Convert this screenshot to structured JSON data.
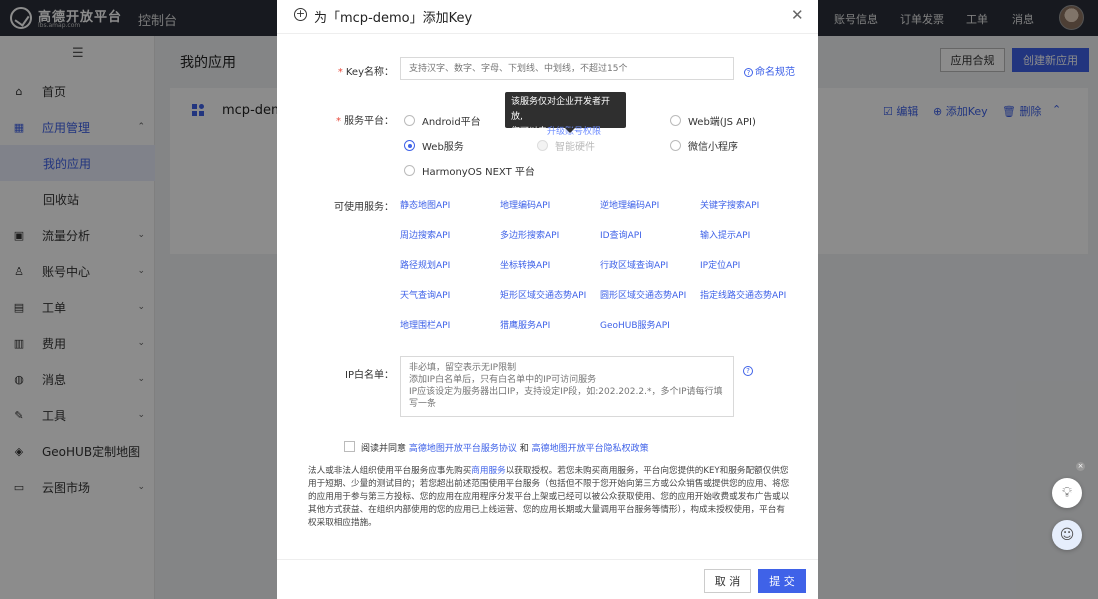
{
  "topbar": {
    "logo_title": "高德开放平台",
    "logo_subtitle": "lbs.amap.com",
    "console": "控制台",
    "nav": [
      "账号信息",
      "订单发票",
      "工单",
      "消息"
    ]
  },
  "sidebar": {
    "items": [
      {
        "label": "首页",
        "icon": "home-icon"
      },
      {
        "label": "应用管理",
        "icon": "grid-icon"
      },
      {
        "label": "我的应用"
      },
      {
        "label": "回收站"
      },
      {
        "label": "流量分析",
        "icon": "chart-icon"
      },
      {
        "label": "账号中心",
        "icon": "user-icon"
      },
      {
        "label": "工单",
        "icon": "ticket-icon"
      },
      {
        "label": "费用",
        "icon": "money-icon"
      },
      {
        "label": "消息",
        "icon": "message-icon"
      },
      {
        "label": "工具",
        "icon": "wrench-icon"
      },
      {
        "label": "GeoHUB定制地图",
        "icon": "layers-icon"
      },
      {
        "label": "云图市场",
        "icon": "cloud-icon"
      }
    ]
  },
  "main": {
    "title": "我的应用",
    "compliance_button": "应用合规",
    "create_button": "创建新应用",
    "app_name": "mcp-demo",
    "actions": {
      "edit": "编辑",
      "add_key": "添加Key",
      "delete": "删除"
    }
  },
  "modal": {
    "title": "为「mcp-demo」添加Key",
    "key_name_label": "Key名称：",
    "key_name_placeholder": "支持汉字、数字、字母、下划线、中划线，不超过15个",
    "naming_rules": "命名规范",
    "platform_label": "服务平台：",
    "platforms": [
      "Android平台",
      "iOS平台",
      "Web端(JS API)",
      "Web服务",
      "智能硬件",
      "微信小程序",
      "HarmonyOS NEXT 平台"
    ],
    "selected_platform": "Web服务",
    "tooltip_line1": "该服务仅对企业开发者开放,",
    "tooltip_line2_prefix": "您可以去",
    "tooltip_link": "升级账号权限",
    "services_label": "可使用服务：",
    "services": [
      "静态地图API",
      "地理编码API",
      "逆地理编码API",
      "关键字搜索API",
      "周边搜索API",
      "多边形搜索API",
      "ID查询API",
      "输入提示API",
      "路径规划API",
      "坐标转换API",
      "行政区域查询API",
      "IP定位API",
      "天气查询API",
      "矩形区域交通态势API",
      "圆形区域交通态势API",
      "指定线路交通态势API",
      "地理围栏API",
      "猎鹰服务API",
      "GeoHUB服务API"
    ],
    "ip_label": "IP白名单：",
    "ip_placeholder": "非必填，留空表示无IP限制\n添加IP白名单后，只有白名单中的IP可访问服务\nIP应该设定为服务器出口IP，支持设定IP段，如:202.202.2.*，多个IP请每行填写一条",
    "agree_prefix": "阅读并同意",
    "agree_link1": "高德地图开放平台服务协议",
    "agree_and": "和",
    "agree_link2": "高德地图开放平台隐私权政策",
    "notice_part1": "法人或非法人组织使用平台服务应事先购买",
    "notice_link": "商用服务",
    "notice_part2": "以获取授权。若您未购买商用服务，平台向您提供的KEY和服务配额仅供您用于短期、少量的测试目的；若您超出前述范围使用平台服务（包括但不限于您开始向第三方或公众销售或提供您的应用、将您的应用用于参与第三方投标、您的应用在应用程序分发平台上架或已经可以被公众获取使用、您的应用开始收费或发布广告或以其他方式获益、在组织内部使用的您的应用已上线运营、您的应用长期或大量调用平台服务等情形），构成未授权使用，平台有权采取相应措施。",
    "cancel": "取 消",
    "submit": "提 交"
  }
}
